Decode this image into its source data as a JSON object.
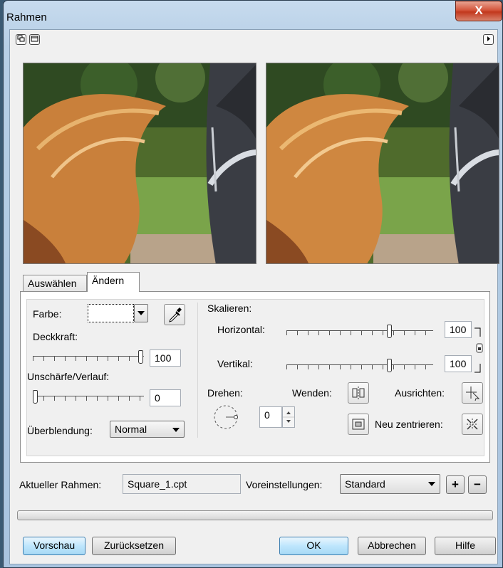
{
  "window": {
    "title": "Rahmen",
    "close_label": "X"
  },
  "tabs": [
    {
      "label": "Auswählen"
    },
    {
      "label": "Ändern"
    }
  ],
  "left_panel": {
    "color_label": "Farbe:",
    "opacity_label": "Deckkraft:",
    "opacity_value": "100",
    "opacity_level": 1.0,
    "blur_label": "Unschärfe/Verlauf:",
    "blur_value": "0",
    "blur_level": 0.0,
    "blend_label": "Überblendung:",
    "blend_value": "Normal"
  },
  "right_panel": {
    "scale_label": "Skalieren:",
    "horizontal_label": "Horizontal:",
    "horizontal_value": "100",
    "horizontal_level": 0.71,
    "vertical_label": "Vertikal:",
    "vertical_value": "100",
    "vertical_level": 0.71,
    "rotate_label": "Drehen:",
    "rotate_value": "0",
    "flip_label": "Wenden:",
    "align_label": "Ausrichten:",
    "recenter_label": "Neu zentrieren:"
  },
  "footer": {
    "current_frame_label": "Aktueller Rahmen:",
    "current_frame_value": "Square_1.cpt",
    "presets_label": "Voreinstellungen:",
    "presets_value": "Standard",
    "add_label": "+",
    "remove_label": "−",
    "preview_label": "Vorschau",
    "reset_label": "Zurücksetzen",
    "ok_label": "OK",
    "cancel_label": "Abbrechen",
    "help_label": "Hilfe"
  }
}
